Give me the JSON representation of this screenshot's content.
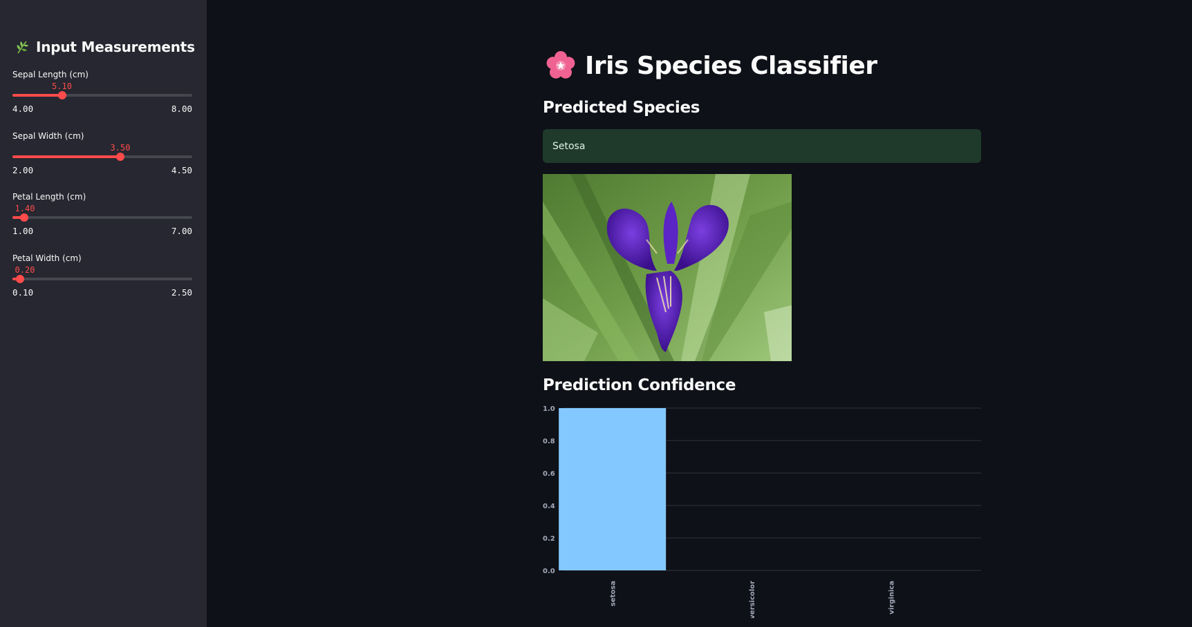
{
  "sidebar": {
    "header": "Input Measurements",
    "header_icon": "herb-icon",
    "sliders": [
      {
        "label": "Sepal Length (cm)",
        "value": "5.10",
        "min": "4.00",
        "max": "8.00",
        "fraction": 0.275
      },
      {
        "label": "Sepal Width (cm)",
        "value": "3.50",
        "min": "2.00",
        "max": "4.50",
        "fraction": 0.6
      },
      {
        "label": "Petal Length (cm)",
        "value": "1.40",
        "min": "1.00",
        "max": "7.00",
        "fraction": 0.0667
      },
      {
        "label": "Petal Width (cm)",
        "value": "0.20",
        "min": "0.10",
        "max": "2.50",
        "fraction": 0.0417
      }
    ]
  },
  "main": {
    "title": "Iris Species Classifier",
    "title_icon": "cherry-blossom-icon",
    "predicted_heading": "Predicted Species",
    "prediction": "Setosa",
    "photo_icon": "iris-flower-photo",
    "confidence_heading": "Prediction Confidence"
  },
  "colors": {
    "accent": "#ff4b4b",
    "bar": "#83c9ff",
    "success_bg": "#1f3a2b"
  },
  "chart_data": {
    "type": "bar",
    "categories": [
      "setosa",
      "versicolor",
      "virginica"
    ],
    "values": [
      1.0,
      0.0,
      0.0
    ],
    "ylim": [
      0,
      1.0
    ],
    "yticks": [
      "0.0",
      "0.2",
      "0.4",
      "0.6",
      "0.8",
      "1.0"
    ],
    "grid": true
  }
}
